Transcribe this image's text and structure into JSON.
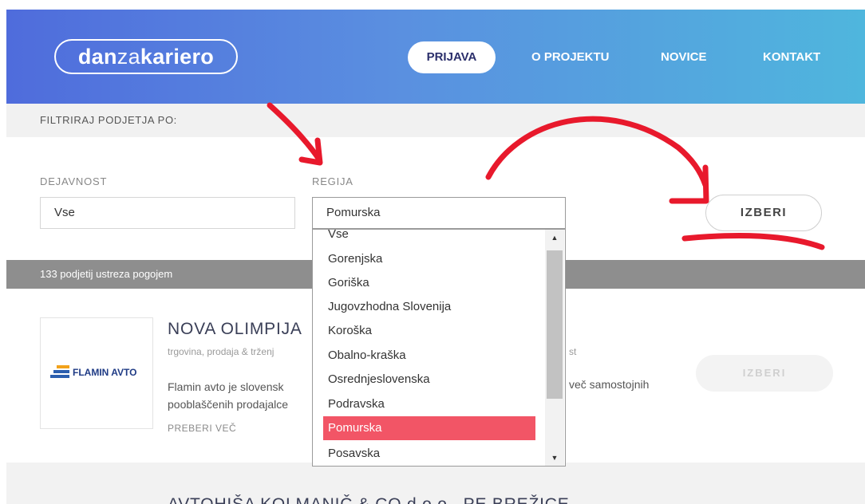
{
  "header": {
    "logo": {
      "part1": "dan",
      "part2": "za",
      "part3": "kariero"
    },
    "nav": {
      "login": "PRIJAVA",
      "about": "O PROJEKTU",
      "news": "NOVICE",
      "contact": "KONTAKT"
    }
  },
  "filter": {
    "title": "FILTRIRAJ PODJETJA PO:",
    "activity_label": "DEJAVNOST",
    "activity_value": "Vse",
    "region_label": "REGIJA",
    "region_value": "Pomurska",
    "submit": "IZBERI"
  },
  "region_dropdown": {
    "options": [
      "Vse",
      "Gorenjska",
      "Goriška",
      "Jugovzhodna Slovenija",
      "Koroška",
      "Obalno-kraška",
      "Osrednjeslovenska",
      "Podravska",
      "Pomurska",
      "Posavska"
    ],
    "selected_index": 8
  },
  "results": {
    "count_text": "133 podjetij ustreza pogojem"
  },
  "company": {
    "logo_text": "FLAMIN AVTO",
    "name": "NOVA OLIMPIJA",
    "category": "trgovina, prodaja & trženj",
    "category_tail": "st",
    "desc_line1": "Flamin avto je slovensk",
    "desc_line2": "pooblaščenih prodajalce",
    "desc_tail": "več samostojnih",
    "read_more": "PREBERI VEČ",
    "select": "IZBERI",
    "logo_colors": [
      "#f2a21b",
      "#2b5eae",
      "#2b5eae"
    ]
  },
  "next_company": {
    "name": "AVTOHIŠA KOLMANIČ & CO d.o.o., PE BREŽICE"
  },
  "colors": {
    "accent": "#f25566",
    "annotation": "#e8192c"
  }
}
